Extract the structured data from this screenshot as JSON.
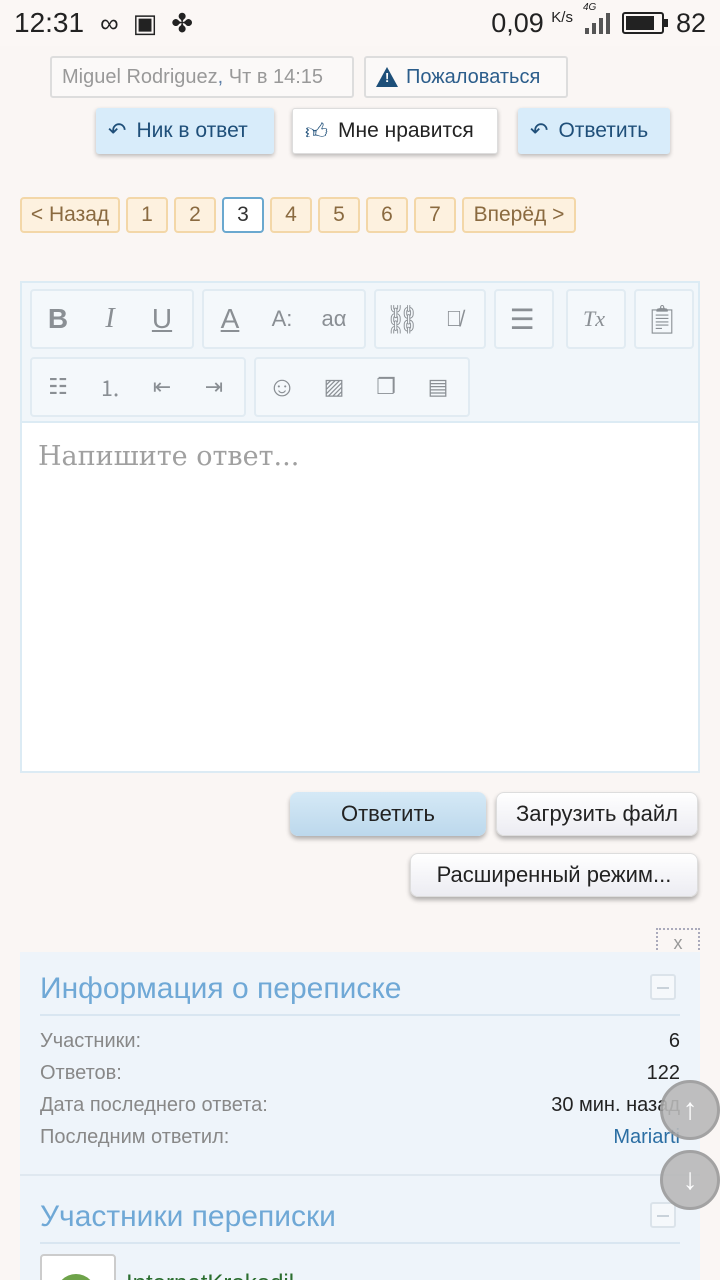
{
  "status_bar": {
    "time": "12:31",
    "speed": "0,09",
    "speed_unit": "K/s",
    "network": "4G",
    "battery": "82",
    "icons": [
      "infinity-icon",
      "image-icon",
      "fan-icon"
    ]
  },
  "post": {
    "author": "Miguel Rodriguez",
    "separator": ",",
    "date": "Чт в 14:15",
    "report_label": "Пожаловаться",
    "quote_nick_label": "Ник в ответ",
    "like_label": "Мне нравится",
    "reply_label": "Ответить"
  },
  "pagination": {
    "prev": "< Назад",
    "pages": [
      "1",
      "2",
      "3",
      "4",
      "5",
      "6",
      "7"
    ],
    "current": "3",
    "next": "Вперёд >"
  },
  "editor": {
    "placeholder": "Напишите ответ...",
    "toolbar": {
      "bold": "B",
      "italic": "I",
      "underline": "U",
      "font_color": "A",
      "font_size": "A:",
      "font_family": "aα",
      "remove_format": "Tx"
    }
  },
  "actions": {
    "reply": "Ответить",
    "upload": "Загрузить файл",
    "advanced": "Расширенный режим..."
  },
  "close_label": "x",
  "thread_info": {
    "title": "Информация о переписке",
    "rows": [
      {
        "key": "Участники:",
        "value": "6"
      },
      {
        "key": "Ответов:",
        "value": "122"
      },
      {
        "key": "Дата последнего ответа:",
        "value": "30 мин. назад"
      },
      {
        "key": "Последним ответил:",
        "value": "Mariarti"
      }
    ]
  },
  "participants": {
    "title": "Участники переписки",
    "members": [
      {
        "name": "InternetKrokodil"
      }
    ]
  },
  "colors": {
    "accent_blue": "#6fa8d6",
    "link": "#2b6ea3",
    "pager_bg": "#fdf1df"
  }
}
